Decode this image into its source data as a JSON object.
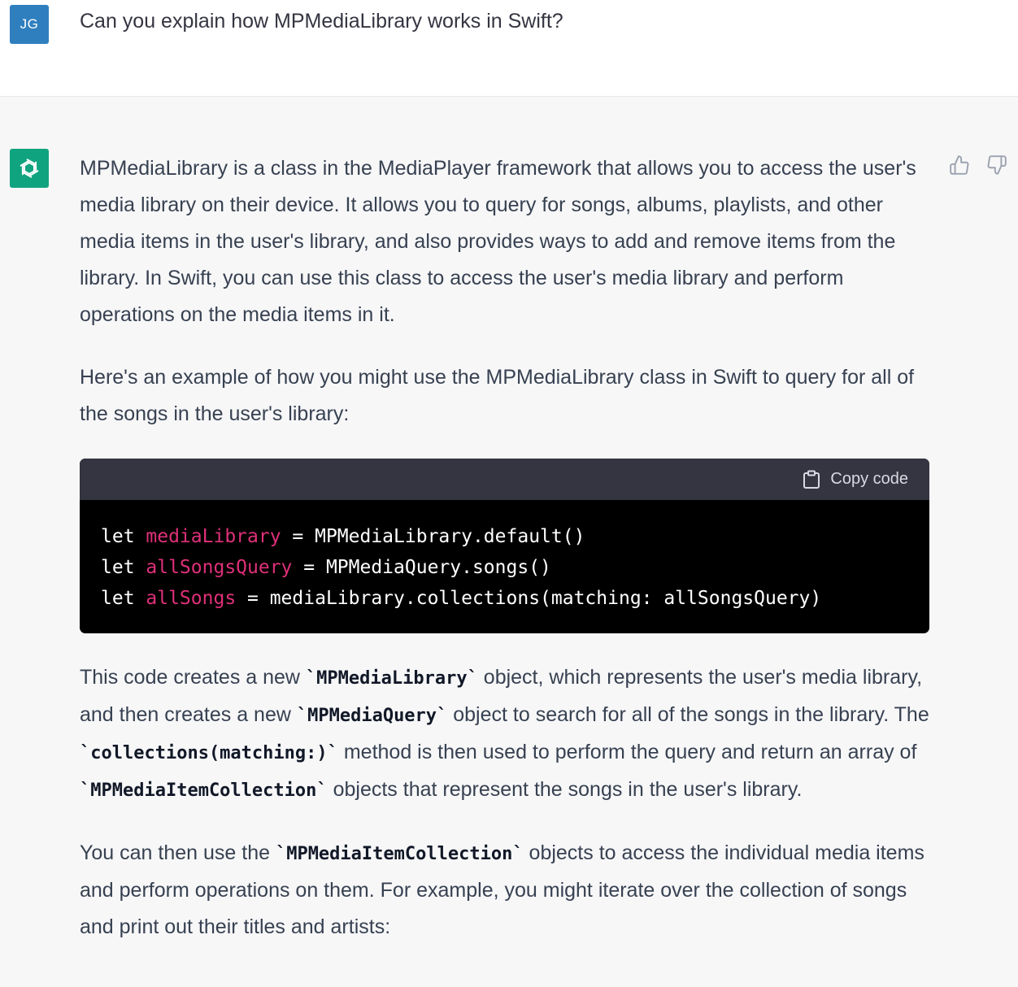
{
  "user": {
    "initials": "JG",
    "message": "Can you explain how MPMediaLibrary works in Swift?"
  },
  "assistant": {
    "avatar_icon": "openai-logo-icon",
    "feedback": {
      "thumbs_up_icon": "thumbs-up-icon",
      "thumbs_down_icon": "thumbs-down-icon"
    },
    "p1": "MPMediaLibrary is a class in the MediaPlayer framework that allows you to access the user's media library on their device. It allows you to query for songs, albums, playlists, and other media items in the user's library, and also provides ways to add and remove items from the library. In Swift, you can use this class to access the user's media library and perform operations on the media items in it.",
    "p2": "Here's an example of how you might use the MPMediaLibrary class in Swift to query for all of the songs in the user's library:",
    "code": {
      "copy_label": "Copy code",
      "lines": [
        {
          "kw": "let ",
          "var": "mediaLibrary",
          "rest": " = MPMediaLibrary.default()"
        },
        {
          "kw": "let ",
          "var": "allSongsQuery",
          "rest": " = MPMediaQuery.songs()"
        },
        {
          "kw": "let ",
          "var": "allSongs",
          "rest": " = mediaLibrary.collections(matching: allSongsQuery)"
        }
      ]
    },
    "p3": {
      "t1": "This code creates a new ",
      "c1": "`MPMediaLibrary`",
      "t2": " object, which represents the user's media library, and then creates a new ",
      "c2": "`MPMediaQuery`",
      "t3": " object to search for all of the songs in the library. The ",
      "c3": "`collections(matching:)`",
      "t4": " method is then used to perform the query and return an array of ",
      "c4": "`MPMediaItemCollection`",
      "t5": " objects that represent the songs in the user's library."
    },
    "p4": {
      "t1": "You can then use the ",
      "c1": "`MPMediaItemCollection`",
      "t2": " objects to access the individual media items and perform operations on them. For example, you might iterate over the collection of songs and print out their titles and artists:"
    }
  },
  "colors": {
    "user_avatar": "#2f7fbf",
    "assistant_avatar": "#10a37f",
    "code_variable": "#df3079",
    "code_header": "#343541"
  }
}
